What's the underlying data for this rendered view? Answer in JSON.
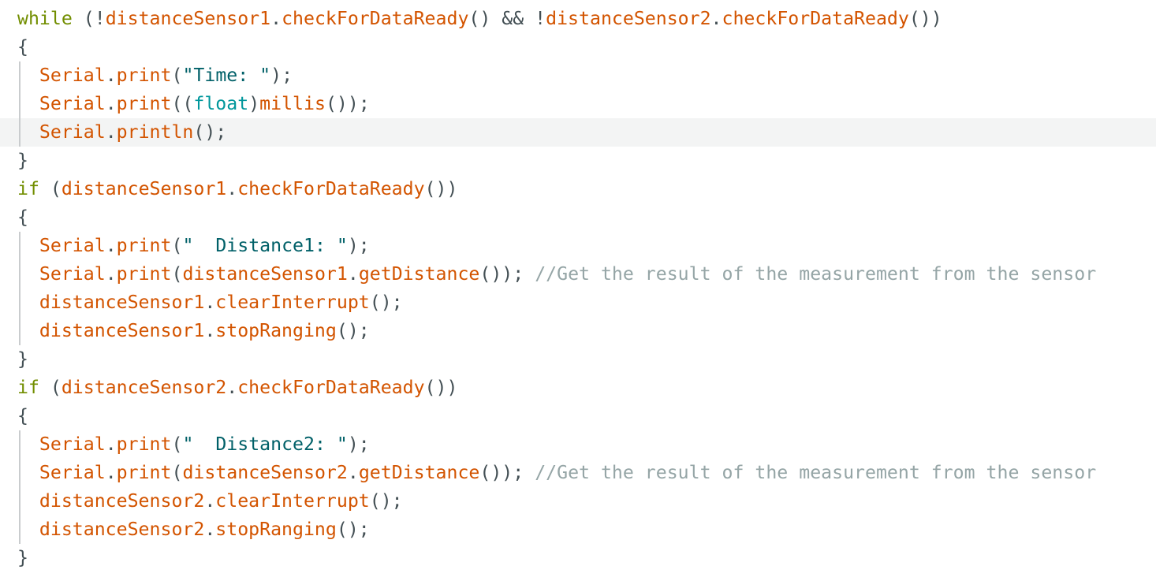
{
  "editor": {
    "language": "arduino-cpp",
    "theme": "arduino-light",
    "background": "#ffffff",
    "highlight_color": "#f3f4f4",
    "indent_guide_color": "#c9ccce",
    "colors": {
      "keyword": "#728e00",
      "identifier": "#d35400",
      "function": "#d35400",
      "string": "#006068",
      "type": "#00979c",
      "comment": "#95a5a6",
      "punctuation": "#434f54"
    },
    "cursor_line": 4
  },
  "code": {
    "lines": [
      {
        "n": 1,
        "highlight": false,
        "guide": false,
        "tokens": [
          {
            "t": "kw",
            "v": "while"
          },
          {
            "t": "plain",
            "v": " ("
          },
          {
            "t": "punc",
            "v": "!"
          },
          {
            "t": "ident",
            "v": "distanceSensor1"
          },
          {
            "t": "punc",
            "v": "."
          },
          {
            "t": "func",
            "v": "checkForDataReady"
          },
          {
            "t": "plain",
            "v": "() && "
          },
          {
            "t": "punc",
            "v": "!"
          },
          {
            "t": "ident",
            "v": "distanceSensor2"
          },
          {
            "t": "punc",
            "v": "."
          },
          {
            "t": "func",
            "v": "checkForDataReady"
          },
          {
            "t": "plain",
            "v": "())"
          }
        ]
      },
      {
        "n": 2,
        "highlight": false,
        "guide": false,
        "tokens": [
          {
            "t": "plain",
            "v": "{"
          }
        ]
      },
      {
        "n": 3,
        "highlight": false,
        "guide": true,
        "tokens": [
          {
            "t": "plain",
            "v": "  "
          },
          {
            "t": "ident",
            "v": "Serial"
          },
          {
            "t": "punc",
            "v": "."
          },
          {
            "t": "func",
            "v": "print"
          },
          {
            "t": "plain",
            "v": "("
          },
          {
            "t": "str",
            "v": "\"Time: \""
          },
          {
            "t": "plain",
            "v": ");"
          }
        ]
      },
      {
        "n": 4,
        "highlight": false,
        "guide": true,
        "tokens": [
          {
            "t": "plain",
            "v": "  "
          },
          {
            "t": "ident",
            "v": "Serial"
          },
          {
            "t": "punc",
            "v": "."
          },
          {
            "t": "func",
            "v": "print"
          },
          {
            "t": "plain",
            "v": "(("
          },
          {
            "t": "type",
            "v": "float"
          },
          {
            "t": "plain",
            "v": ")"
          },
          {
            "t": "func",
            "v": "millis"
          },
          {
            "t": "plain",
            "v": "());"
          }
        ]
      },
      {
        "n": 5,
        "highlight": true,
        "guide": true,
        "tokens": [
          {
            "t": "plain",
            "v": "  "
          },
          {
            "t": "ident",
            "v": "Serial"
          },
          {
            "t": "punc",
            "v": "."
          },
          {
            "t": "func",
            "v": "println"
          },
          {
            "t": "plain",
            "v": "();"
          }
        ]
      },
      {
        "n": 6,
        "highlight": false,
        "guide": false,
        "tokens": [
          {
            "t": "plain",
            "v": "}"
          }
        ]
      },
      {
        "n": 7,
        "highlight": false,
        "guide": false,
        "tokens": [
          {
            "t": "kw",
            "v": "if"
          },
          {
            "t": "plain",
            "v": " ("
          },
          {
            "t": "ident",
            "v": "distanceSensor1"
          },
          {
            "t": "punc",
            "v": "."
          },
          {
            "t": "func",
            "v": "checkForDataReady"
          },
          {
            "t": "plain",
            "v": "())"
          }
        ]
      },
      {
        "n": 8,
        "highlight": false,
        "guide": false,
        "tokens": [
          {
            "t": "plain",
            "v": "{"
          }
        ]
      },
      {
        "n": 9,
        "highlight": false,
        "guide": true,
        "tokens": [
          {
            "t": "plain",
            "v": "  "
          },
          {
            "t": "ident",
            "v": "Serial"
          },
          {
            "t": "punc",
            "v": "."
          },
          {
            "t": "func",
            "v": "print"
          },
          {
            "t": "plain",
            "v": "("
          },
          {
            "t": "str",
            "v": "\"  Distance1: \""
          },
          {
            "t": "plain",
            "v": ");"
          }
        ]
      },
      {
        "n": 10,
        "highlight": false,
        "guide": true,
        "tokens": [
          {
            "t": "plain",
            "v": "  "
          },
          {
            "t": "ident",
            "v": "Serial"
          },
          {
            "t": "punc",
            "v": "."
          },
          {
            "t": "func",
            "v": "print"
          },
          {
            "t": "plain",
            "v": "("
          },
          {
            "t": "ident",
            "v": "distanceSensor1"
          },
          {
            "t": "punc",
            "v": "."
          },
          {
            "t": "func",
            "v": "getDistance"
          },
          {
            "t": "plain",
            "v": "()); "
          },
          {
            "t": "comment",
            "v": "//Get the result of the measurement from the sensor"
          }
        ]
      },
      {
        "n": 11,
        "highlight": false,
        "guide": true,
        "tokens": [
          {
            "t": "plain",
            "v": "  "
          },
          {
            "t": "ident",
            "v": "distanceSensor1"
          },
          {
            "t": "punc",
            "v": "."
          },
          {
            "t": "func",
            "v": "clearInterrupt"
          },
          {
            "t": "plain",
            "v": "();"
          }
        ]
      },
      {
        "n": 12,
        "highlight": false,
        "guide": true,
        "tokens": [
          {
            "t": "plain",
            "v": "  "
          },
          {
            "t": "ident",
            "v": "distanceSensor1"
          },
          {
            "t": "punc",
            "v": "."
          },
          {
            "t": "func",
            "v": "stopRanging"
          },
          {
            "t": "plain",
            "v": "();"
          }
        ]
      },
      {
        "n": 13,
        "highlight": false,
        "guide": false,
        "tokens": [
          {
            "t": "plain",
            "v": "}"
          }
        ]
      },
      {
        "n": 14,
        "highlight": false,
        "guide": false,
        "tokens": [
          {
            "t": "kw",
            "v": "if"
          },
          {
            "t": "plain",
            "v": " ("
          },
          {
            "t": "ident",
            "v": "distanceSensor2"
          },
          {
            "t": "punc",
            "v": "."
          },
          {
            "t": "func",
            "v": "checkForDataReady"
          },
          {
            "t": "plain",
            "v": "())"
          }
        ]
      },
      {
        "n": 15,
        "highlight": false,
        "guide": false,
        "tokens": [
          {
            "t": "plain",
            "v": "{"
          }
        ]
      },
      {
        "n": 16,
        "highlight": false,
        "guide": true,
        "tokens": [
          {
            "t": "plain",
            "v": "  "
          },
          {
            "t": "ident",
            "v": "Serial"
          },
          {
            "t": "punc",
            "v": "."
          },
          {
            "t": "func",
            "v": "print"
          },
          {
            "t": "plain",
            "v": "("
          },
          {
            "t": "str",
            "v": "\"  Distance2: \""
          },
          {
            "t": "plain",
            "v": ");"
          }
        ]
      },
      {
        "n": 17,
        "highlight": false,
        "guide": true,
        "tokens": [
          {
            "t": "plain",
            "v": "  "
          },
          {
            "t": "ident",
            "v": "Serial"
          },
          {
            "t": "punc",
            "v": "."
          },
          {
            "t": "func",
            "v": "print"
          },
          {
            "t": "plain",
            "v": "("
          },
          {
            "t": "ident",
            "v": "distanceSensor2"
          },
          {
            "t": "punc",
            "v": "."
          },
          {
            "t": "func",
            "v": "getDistance"
          },
          {
            "t": "plain",
            "v": "()); "
          },
          {
            "t": "comment",
            "v": "//Get the result of the measurement from the sensor"
          }
        ]
      },
      {
        "n": 18,
        "highlight": false,
        "guide": true,
        "tokens": [
          {
            "t": "plain",
            "v": "  "
          },
          {
            "t": "ident",
            "v": "distanceSensor2"
          },
          {
            "t": "punc",
            "v": "."
          },
          {
            "t": "func",
            "v": "clearInterrupt"
          },
          {
            "t": "plain",
            "v": "();"
          }
        ]
      },
      {
        "n": 19,
        "highlight": false,
        "guide": true,
        "tokens": [
          {
            "t": "plain",
            "v": "  "
          },
          {
            "t": "ident",
            "v": "distanceSensor2"
          },
          {
            "t": "punc",
            "v": "."
          },
          {
            "t": "func",
            "v": "stopRanging"
          },
          {
            "t": "plain",
            "v": "();"
          }
        ]
      },
      {
        "n": 20,
        "highlight": false,
        "guide": false,
        "tokens": [
          {
            "t": "plain",
            "v": "}"
          }
        ]
      }
    ]
  }
}
